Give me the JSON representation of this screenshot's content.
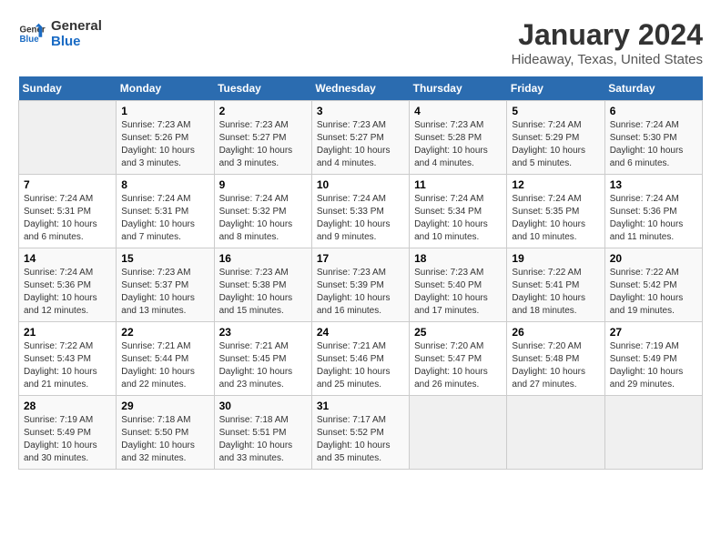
{
  "header": {
    "logo_line1": "General",
    "logo_line2": "Blue",
    "title": "January 2024",
    "subtitle": "Hideaway, Texas, United States"
  },
  "columns": [
    "Sunday",
    "Monday",
    "Tuesday",
    "Wednesday",
    "Thursday",
    "Friday",
    "Saturday"
  ],
  "weeks": [
    [
      {
        "day": "",
        "sunrise": "",
        "sunset": "",
        "daylight": ""
      },
      {
        "day": "1",
        "sunrise": "Sunrise: 7:23 AM",
        "sunset": "Sunset: 5:26 PM",
        "daylight": "Daylight: 10 hours and 3 minutes."
      },
      {
        "day": "2",
        "sunrise": "Sunrise: 7:23 AM",
        "sunset": "Sunset: 5:27 PM",
        "daylight": "Daylight: 10 hours and 3 minutes."
      },
      {
        "day": "3",
        "sunrise": "Sunrise: 7:23 AM",
        "sunset": "Sunset: 5:27 PM",
        "daylight": "Daylight: 10 hours and 4 minutes."
      },
      {
        "day": "4",
        "sunrise": "Sunrise: 7:23 AM",
        "sunset": "Sunset: 5:28 PM",
        "daylight": "Daylight: 10 hours and 4 minutes."
      },
      {
        "day": "5",
        "sunrise": "Sunrise: 7:24 AM",
        "sunset": "Sunset: 5:29 PM",
        "daylight": "Daylight: 10 hours and 5 minutes."
      },
      {
        "day": "6",
        "sunrise": "Sunrise: 7:24 AM",
        "sunset": "Sunset: 5:30 PM",
        "daylight": "Daylight: 10 hours and 6 minutes."
      }
    ],
    [
      {
        "day": "7",
        "sunrise": "Sunrise: 7:24 AM",
        "sunset": "Sunset: 5:31 PM",
        "daylight": "Daylight: 10 hours and 6 minutes."
      },
      {
        "day": "8",
        "sunrise": "Sunrise: 7:24 AM",
        "sunset": "Sunset: 5:31 PM",
        "daylight": "Daylight: 10 hours and 7 minutes."
      },
      {
        "day": "9",
        "sunrise": "Sunrise: 7:24 AM",
        "sunset": "Sunset: 5:32 PM",
        "daylight": "Daylight: 10 hours and 8 minutes."
      },
      {
        "day": "10",
        "sunrise": "Sunrise: 7:24 AM",
        "sunset": "Sunset: 5:33 PM",
        "daylight": "Daylight: 10 hours and 9 minutes."
      },
      {
        "day": "11",
        "sunrise": "Sunrise: 7:24 AM",
        "sunset": "Sunset: 5:34 PM",
        "daylight": "Daylight: 10 hours and 10 minutes."
      },
      {
        "day": "12",
        "sunrise": "Sunrise: 7:24 AM",
        "sunset": "Sunset: 5:35 PM",
        "daylight": "Daylight: 10 hours and 10 minutes."
      },
      {
        "day": "13",
        "sunrise": "Sunrise: 7:24 AM",
        "sunset": "Sunset: 5:36 PM",
        "daylight": "Daylight: 10 hours and 11 minutes."
      }
    ],
    [
      {
        "day": "14",
        "sunrise": "Sunrise: 7:24 AM",
        "sunset": "Sunset: 5:36 PM",
        "daylight": "Daylight: 10 hours and 12 minutes."
      },
      {
        "day": "15",
        "sunrise": "Sunrise: 7:23 AM",
        "sunset": "Sunset: 5:37 PM",
        "daylight": "Daylight: 10 hours and 13 minutes."
      },
      {
        "day": "16",
        "sunrise": "Sunrise: 7:23 AM",
        "sunset": "Sunset: 5:38 PM",
        "daylight": "Daylight: 10 hours and 15 minutes."
      },
      {
        "day": "17",
        "sunrise": "Sunrise: 7:23 AM",
        "sunset": "Sunset: 5:39 PM",
        "daylight": "Daylight: 10 hours and 16 minutes."
      },
      {
        "day": "18",
        "sunrise": "Sunrise: 7:23 AM",
        "sunset": "Sunset: 5:40 PM",
        "daylight": "Daylight: 10 hours and 17 minutes."
      },
      {
        "day": "19",
        "sunrise": "Sunrise: 7:22 AM",
        "sunset": "Sunset: 5:41 PM",
        "daylight": "Daylight: 10 hours and 18 minutes."
      },
      {
        "day": "20",
        "sunrise": "Sunrise: 7:22 AM",
        "sunset": "Sunset: 5:42 PM",
        "daylight": "Daylight: 10 hours and 19 minutes."
      }
    ],
    [
      {
        "day": "21",
        "sunrise": "Sunrise: 7:22 AM",
        "sunset": "Sunset: 5:43 PM",
        "daylight": "Daylight: 10 hours and 21 minutes."
      },
      {
        "day": "22",
        "sunrise": "Sunrise: 7:21 AM",
        "sunset": "Sunset: 5:44 PM",
        "daylight": "Daylight: 10 hours and 22 minutes."
      },
      {
        "day": "23",
        "sunrise": "Sunrise: 7:21 AM",
        "sunset": "Sunset: 5:45 PM",
        "daylight": "Daylight: 10 hours and 23 minutes."
      },
      {
        "day": "24",
        "sunrise": "Sunrise: 7:21 AM",
        "sunset": "Sunset: 5:46 PM",
        "daylight": "Daylight: 10 hours and 25 minutes."
      },
      {
        "day": "25",
        "sunrise": "Sunrise: 7:20 AM",
        "sunset": "Sunset: 5:47 PM",
        "daylight": "Daylight: 10 hours and 26 minutes."
      },
      {
        "day": "26",
        "sunrise": "Sunrise: 7:20 AM",
        "sunset": "Sunset: 5:48 PM",
        "daylight": "Daylight: 10 hours and 27 minutes."
      },
      {
        "day": "27",
        "sunrise": "Sunrise: 7:19 AM",
        "sunset": "Sunset: 5:49 PM",
        "daylight": "Daylight: 10 hours and 29 minutes."
      }
    ],
    [
      {
        "day": "28",
        "sunrise": "Sunrise: 7:19 AM",
        "sunset": "Sunset: 5:49 PM",
        "daylight": "Daylight: 10 hours and 30 minutes."
      },
      {
        "day": "29",
        "sunrise": "Sunrise: 7:18 AM",
        "sunset": "Sunset: 5:50 PM",
        "daylight": "Daylight: 10 hours and 32 minutes."
      },
      {
        "day": "30",
        "sunrise": "Sunrise: 7:18 AM",
        "sunset": "Sunset: 5:51 PM",
        "daylight": "Daylight: 10 hours and 33 minutes."
      },
      {
        "day": "31",
        "sunrise": "Sunrise: 7:17 AM",
        "sunset": "Sunset: 5:52 PM",
        "daylight": "Daylight: 10 hours and 35 minutes."
      },
      {
        "day": "",
        "sunrise": "",
        "sunset": "",
        "daylight": ""
      },
      {
        "day": "",
        "sunrise": "",
        "sunset": "",
        "daylight": ""
      },
      {
        "day": "",
        "sunrise": "",
        "sunset": "",
        "daylight": ""
      }
    ]
  ]
}
